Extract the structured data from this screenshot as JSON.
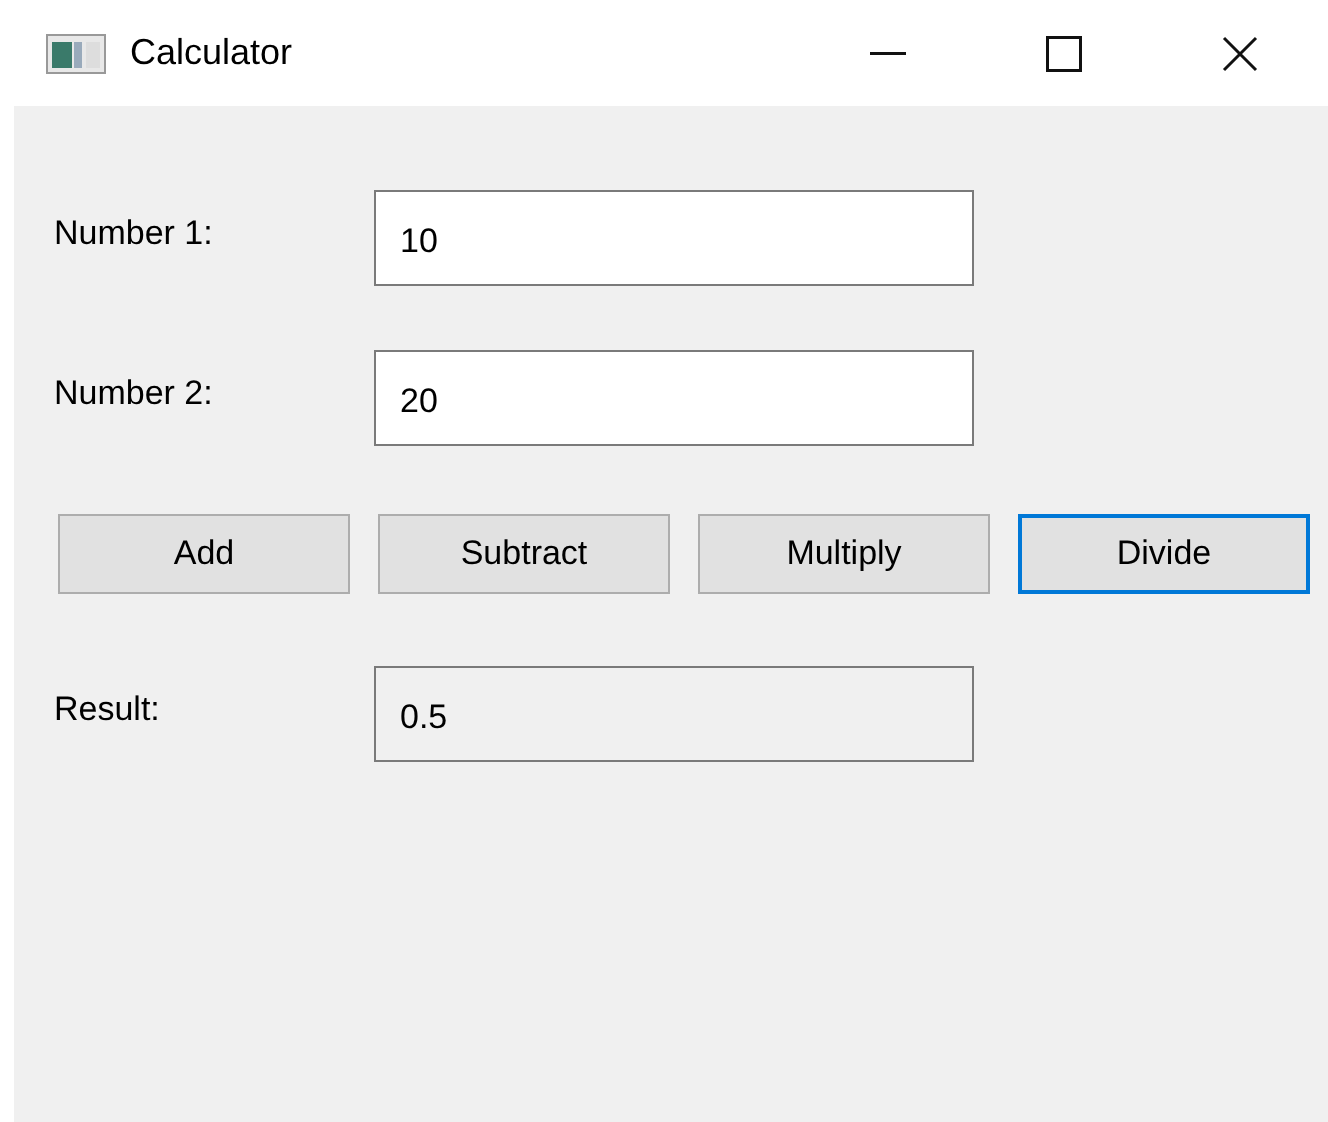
{
  "window": {
    "title": "Calculator"
  },
  "fields": [
    {
      "label": "Number 1:",
      "value": "10",
      "readonly": false
    },
    {
      "label": "Number 2:",
      "value": "20",
      "readonly": false
    }
  ],
  "buttons": [
    {
      "label": "Add",
      "focused": false
    },
    {
      "label": "Subtract",
      "focused": false
    },
    {
      "label": "Multiply",
      "focused": false
    },
    {
      "label": "Divide",
      "focused": true
    }
  ],
  "result": {
    "label": "Result:",
    "value": "0.5",
    "readonly": true
  }
}
